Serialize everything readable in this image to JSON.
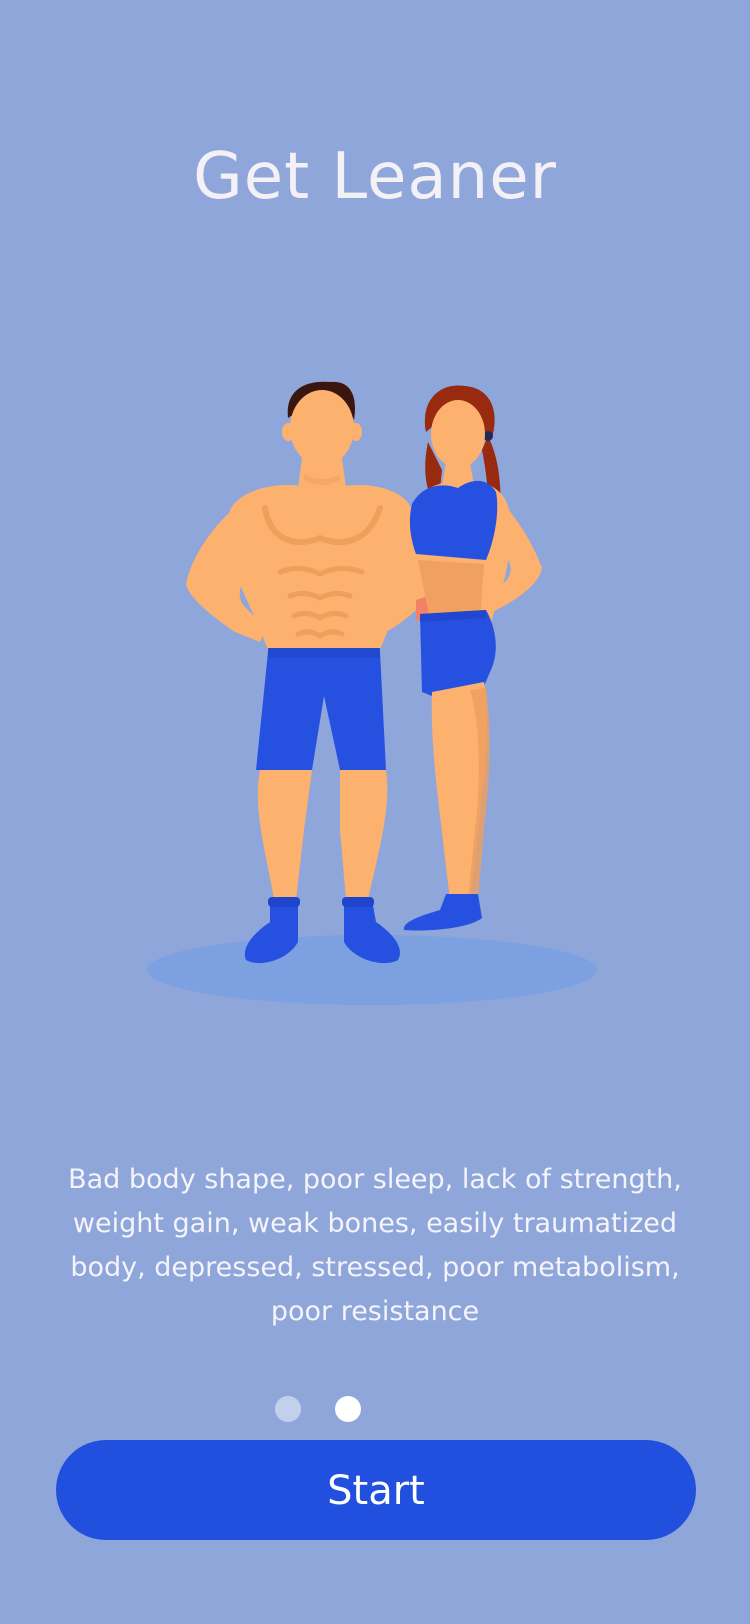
{
  "onboarding": {
    "title": "Get Leaner",
    "description_lines": [
      "Bad body shape, poor sleep, lack of strength,",
      "weight gain, weak bones, easily traumatized",
      "body, depressed, stressed, poor metabolism,",
      "poor resistance"
    ],
    "pager": {
      "total_pages": 2,
      "current_page": 2
    },
    "start_label": "Start"
  },
  "colors": {
    "background": "#8fa6da",
    "primary": "#2250de",
    "skin": "#fdb16f",
    "shorts": "#2651e0"
  },
  "icons": {
    "illustration": "fit-couple-illustration"
  }
}
